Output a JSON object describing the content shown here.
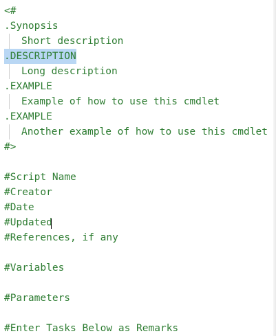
{
  "editor": {
    "lines": [
      "<#",
      ".Synopsis",
      "Short description",
      ".DESCRIPTION",
      "Long description",
      ".EXAMPLE",
      "Example of how to use this cmdlet",
      ".EXAMPLE",
      "Another example of how to use this cmdlet",
      "#>",
      "",
      "#Script Name",
      "#Creator",
      "#Date",
      "#Updated",
      "#References, if any",
      "",
      "#Variables",
      "",
      "#Parameters",
      "",
      "#Enter Tasks Below as Remarks"
    ],
    "selected_text": ".DESCRIPTION",
    "text_color": "#2e7d32",
    "selection_color": "#b9d7f4"
  }
}
